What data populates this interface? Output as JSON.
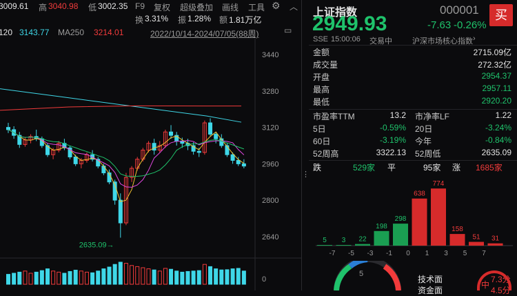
{
  "topbar": {
    "open_label": "开",
    "open_value": "3009.61",
    "high_label": "高",
    "high_value": "3040.98",
    "low_label": "低",
    "low_value": "3002.35",
    "f9": "F9",
    "fuquan": "复权",
    "super_overlay": "超级叠加",
    "draw_line": "画线",
    "tools": "工具",
    "turnover_label": "换",
    "turnover_value": "3.31%",
    "amplitude_label": "振",
    "amplitude_value": "1.28%",
    "amount_label": "额",
    "amount_value": "1.81万亿"
  },
  "mabar": {
    "ma120_label": "120",
    "ma120_value": "3143.77",
    "ma250_label": "MA250",
    "ma250_value": "3214.01",
    "range": "2022/10/14-2024/07/05(88周)"
  },
  "chart_data": {
    "type": "candlestick",
    "y_ticks": [
      "3440",
      "3280",
      "3120",
      "2960",
      "2800",
      "2640"
    ],
    "ylim": [
      2600,
      3480
    ],
    "annotation": "2635.09",
    "volume_axis_label": "0",
    "candles": [
      [
        3120,
        3140,
        3095,
        3110
      ],
      [
        3110,
        3125,
        3070,
        3085
      ],
      [
        3085,
        3100,
        3030,
        3045
      ],
      [
        3045,
        3075,
        3035,
        3065
      ],
      [
        3065,
        3090,
        3050,
        3080
      ],
      [
        3080,
        3110,
        3060,
        3070
      ],
      [
        3070,
        3080,
        3030,
        3040
      ],
      [
        3040,
        3050,
        2990,
        3000
      ],
      [
        3000,
        3030,
        2980,
        3020
      ],
      [
        3020,
        3060,
        3010,
        3050
      ],
      [
        3050,
        3070,
        3020,
        3030
      ],
      [
        3030,
        3040,
        2980,
        2990
      ],
      [
        2990,
        3000,
        2950,
        2960
      ],
      [
        2960,
        2985,
        2940,
        2975
      ],
      [
        2975,
        3010,
        2965,
        3000
      ],
      [
        3000,
        3020,
        2970,
        2980
      ],
      [
        2980,
        2990,
        2940,
        2950
      ],
      [
        2950,
        2960,
        2910,
        2920
      ],
      [
        2920,
        2935,
        2870,
        2880
      ],
      [
        2880,
        2890,
        2780,
        2800
      ],
      [
        2800,
        2830,
        2635,
        2700
      ],
      [
        2700,
        2920,
        2690,
        2900
      ],
      [
        2900,
        2950,
        2880,
        2940
      ],
      [
        2940,
        2990,
        2930,
        2980
      ],
      [
        2980,
        3030,
        2970,
        3020
      ],
      [
        3020,
        3060,
        3010,
        3050
      ],
      [
        3050,
        3070,
        3000,
        3020
      ],
      [
        3020,
        3060,
        3010,
        3040
      ],
      [
        3040,
        3110,
        3030,
        3100
      ],
      [
        3100,
        3130,
        3070,
        3085
      ],
      [
        3085,
        3100,
        3040,
        3060
      ],
      [
        3060,
        3075,
        3030,
        3050
      ],
      [
        3050,
        3070,
        3020,
        3040
      ],
      [
        3040,
        3055,
        3000,
        3015
      ],
      [
        3015,
        3030,
        2990,
        3010
      ],
      [
        3010,
        3150,
        3000,
        3140
      ],
      [
        3140,
        3160,
        3080,
        3090
      ],
      [
        3090,
        3100,
        3050,
        3070
      ],
      [
        3070,
        3090,
        3030,
        3040
      ],
      [
        3040,
        3050,
        2990,
        3000
      ],
      [
        3000,
        3010,
        2960,
        2975
      ],
      [
        2975,
        2990,
        2950,
        2960
      ],
      [
        2960,
        2980,
        2940,
        2950
      ]
    ],
    "volumes": [
      0.45,
      0.5,
      0.55,
      0.6,
      0.5,
      0.55,
      0.62,
      0.7,
      0.6,
      0.55,
      0.5,
      0.58,
      0.64,
      0.6,
      0.55,
      0.52,
      0.6,
      0.7,
      0.78,
      0.9,
      1.0,
      0.95,
      0.85,
      0.8,
      0.75,
      0.7,
      0.65,
      0.6,
      0.72,
      0.68,
      0.6,
      0.55,
      0.58,
      0.6,
      0.62,
      0.9,
      0.8,
      0.7,
      0.65,
      0.66,
      0.7,
      0.72,
      0.6
    ]
  },
  "panel": {
    "title": "上证指数",
    "code": "000001",
    "buy_label": "买",
    "price": "2949.93",
    "change": "-7.63",
    "change_pct": "-0.26%",
    "exchange": "SSE",
    "time": "15:00:06",
    "status": "交易中",
    "category": "沪深市场核心指数",
    "stats": [
      {
        "label": "金额",
        "value": "2715.09亿",
        "color": "white"
      },
      {
        "label": "成交量",
        "value": "272.32亿",
        "color": "white"
      },
      {
        "label": "开盘",
        "value": "2954.37",
        "color": "green"
      },
      {
        "label": "最高",
        "value": "2957.11",
        "color": "green"
      },
      {
        "label": "最低",
        "value": "2920.20",
        "color": "green"
      }
    ],
    "grid": [
      {
        "l1": "市盈率TTM",
        "v1": "13.2",
        "c1": "white",
        "l2": "市净率LF",
        "v2": "1.22",
        "c2": "white"
      },
      {
        "l1": "5日",
        "v1": "-0.59%",
        "c1": "green",
        "l2": "20日",
        "v2": "-3.24%",
        "c2": "green"
      },
      {
        "l1": "60日",
        "v1": "-3.19%",
        "c1": "green",
        "l2": "今年",
        "v2": "-0.84%",
        "c2": "green"
      },
      {
        "l1": "52周高",
        "v1": "3322.13",
        "c1": "white",
        "l2": "52周低",
        "v2": "2635.09",
        "c2": "white"
      }
    ],
    "breadth": {
      "down_label": "跌",
      "down_value": "529家",
      "flat_label": "平",
      "flat_value": "95家",
      "up_label": "涨",
      "up_value": "1685家"
    },
    "distribution": {
      "bins": [
        "-7",
        "-5",
        "-3",
        "-1",
        "0",
        "1",
        "3",
        "5",
        "7"
      ],
      "values": [
        5,
        3,
        22,
        198,
        298,
        638,
        774,
        158,
        51,
        31
      ],
      "colors": [
        "green",
        "green",
        "green",
        "green",
        "green",
        "red",
        "red",
        "red",
        "red",
        "red"
      ]
    },
    "gauge_value": "5",
    "bottom": [
      {
        "label": "技术面",
        "value": "7.3分"
      },
      {
        "label": "资金面",
        "value": "4.5分"
      }
    ],
    "medium_label": "中"
  }
}
